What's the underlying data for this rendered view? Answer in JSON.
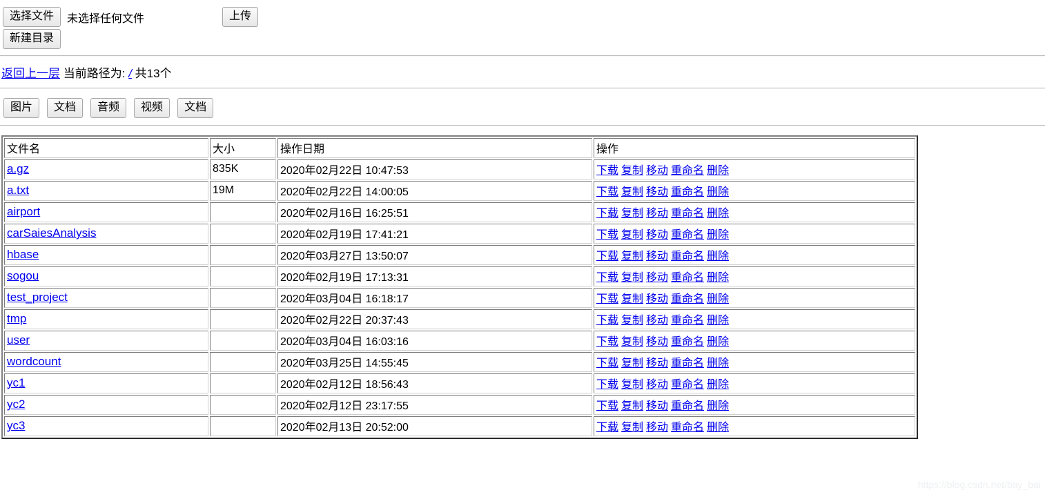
{
  "upload_bar": {
    "choose_file_label": "选择文件",
    "no_file_text": "未选择任何文件",
    "upload_label": "上传",
    "new_dir_label": "新建目录"
  },
  "path_bar": {
    "back_link": "返回上一层",
    "path_prefix": "当前路径为:",
    "current_path": "/",
    "count_text": "共13个"
  },
  "filters": [
    {
      "label": "图片",
      "name": "filter-images"
    },
    {
      "label": "文档",
      "name": "filter-documents"
    },
    {
      "label": "音频",
      "name": "filter-audio"
    },
    {
      "label": "视频",
      "name": "filter-video"
    },
    {
      "label": "文档",
      "name": "filter-documents-2"
    }
  ],
  "table": {
    "headers": {
      "name": "文件名",
      "size": "大小",
      "date": "操作日期",
      "ops": "操作"
    },
    "ops_labels": {
      "download": "下载",
      "copy": "复制",
      "move": "移动",
      "rename": "重命名",
      "delete": "删除"
    },
    "rows": [
      {
        "name": "a.gz",
        "size": "835K",
        "date": "2020年02月22日 10:47:53"
      },
      {
        "name": "a.txt",
        "size": "19M",
        "date": "2020年02月22日 14:00:05"
      },
      {
        "name": "airport",
        "size": "",
        "date": "2020年02月16日 16:25:51"
      },
      {
        "name": "carSaiesAnalysis",
        "size": "",
        "date": "2020年02月19日 17:41:21"
      },
      {
        "name": "hbase",
        "size": "",
        "date": "2020年03月27日 13:50:07"
      },
      {
        "name": "sogou",
        "size": "",
        "date": "2020年02月19日 17:13:31"
      },
      {
        "name": "test_project",
        "size": "",
        "date": "2020年03月04日 16:18:17"
      },
      {
        "name": "tmp",
        "size": "",
        "date": "2020年02月22日 20:37:43"
      },
      {
        "name": "user",
        "size": "",
        "date": "2020年03月04日 16:03:16"
      },
      {
        "name": "wordcount",
        "size": "",
        "date": "2020年03月25日 14:55:45"
      },
      {
        "name": "yc1",
        "size": "",
        "date": "2020年02月12日 18:56:43"
      },
      {
        "name": "yc2",
        "size": "",
        "date": "2020年02月12日 23:17:55"
      },
      {
        "name": "yc3",
        "size": "",
        "date": "2020年02月13日 20:52:00"
      }
    ]
  },
  "watermark": "https://blog.csdn.net/bay_bai",
  "colors": {
    "link": "#0000ee",
    "button_face": "#efefef",
    "button_border": "#a6a6a6",
    "rule": "#bfbfbf",
    "watermark": "#eef0f2"
  }
}
